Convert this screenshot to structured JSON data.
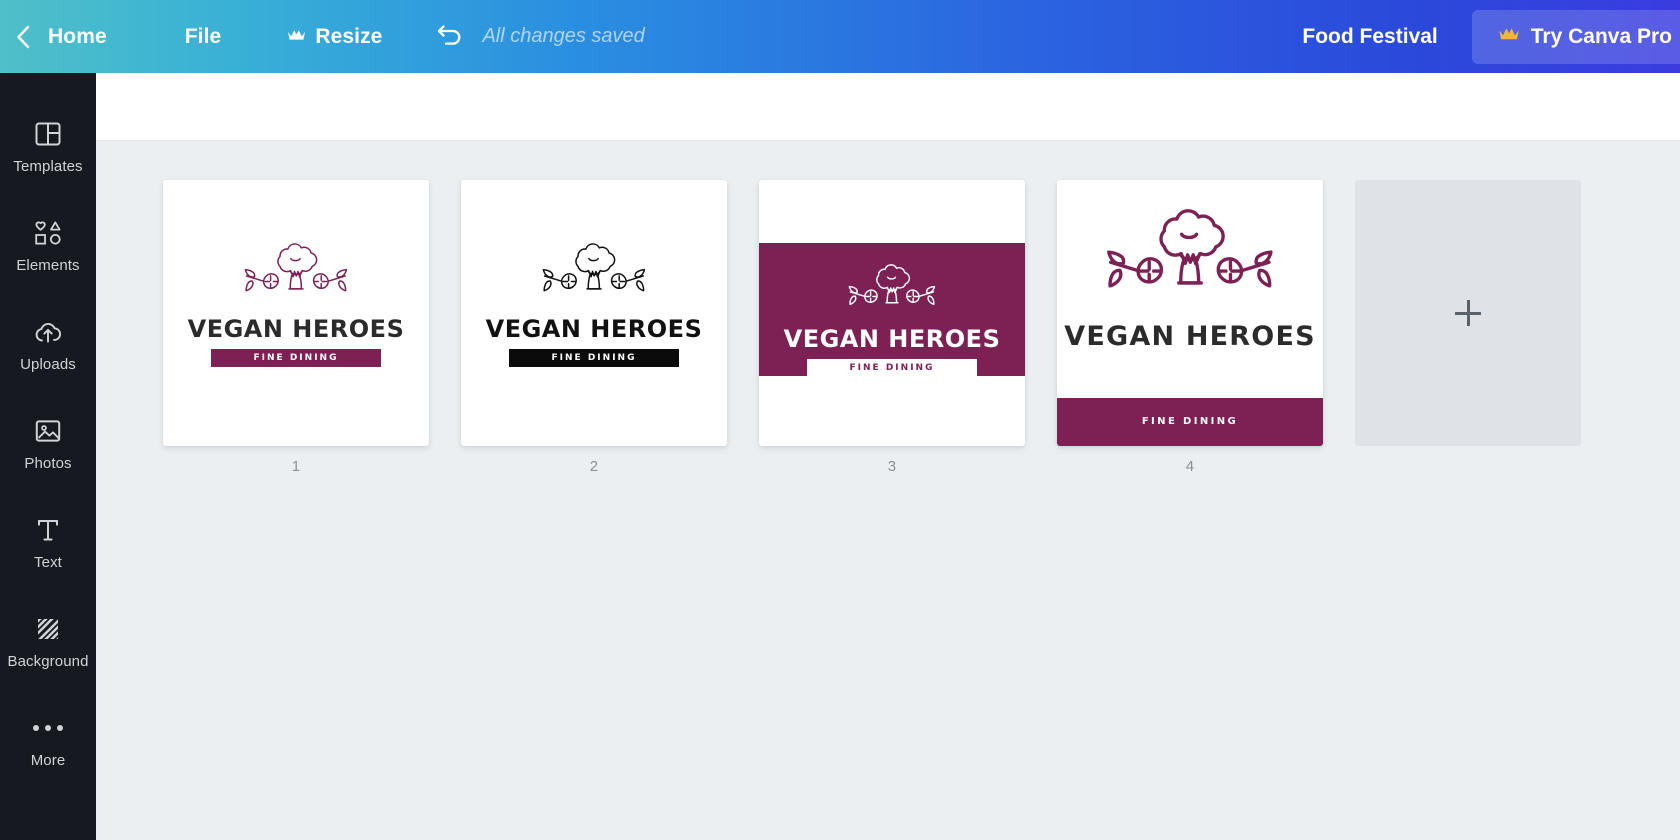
{
  "header": {
    "back_icon": "chevron-left-icon",
    "home_label": "Home",
    "file_label": "File",
    "resize_label": "Resize",
    "resize_crown_icon": "crown-icon",
    "undo_icon": "undo-arrow-icon",
    "save_status": "All changes saved",
    "doc_title": "Food Festival",
    "try_canva_label": "Try Canva Pro",
    "try_canva_crown_icon": "crown-icon",
    "gradient_from": "#4fc0c8",
    "gradient_to": "#3a3ce0"
  },
  "sidebar": {
    "items": [
      {
        "label": "Templates",
        "icon": "templates-icon"
      },
      {
        "label": "Elements",
        "icon": "elements-icon"
      },
      {
        "label": "Uploads",
        "icon": "upload-cloud-icon"
      },
      {
        "label": "Photos",
        "icon": "photo-icon"
      },
      {
        "label": "Text",
        "icon": "text-t-icon"
      },
      {
        "label": "Background",
        "icon": "background-hatch-icon"
      },
      {
        "label": "More",
        "icon": "more-dots-icon"
      }
    ],
    "background_color": "#16191f"
  },
  "canvas": {
    "background_color": "#eceff1",
    "brand_purple": "#7d2154",
    "add_page": {
      "label": "",
      "icon": "plus-icon"
    },
    "pages": [
      {
        "number": "1",
        "variant": "light-purple",
        "brand_name": "VEGAN HEROES",
        "tagline": "FINE DINING",
        "art": "broccoli-logo-icon"
      },
      {
        "number": "2",
        "variant": "black",
        "brand_name": "VEGAN HEROES",
        "tagline": "FINE DINING",
        "art": "broccoli-logo-icon"
      },
      {
        "number": "3",
        "variant": "purple-band",
        "brand_name": "VEGAN HEROES",
        "tagline": "FINE DINING",
        "art": "broccoli-logo-icon"
      },
      {
        "number": "4",
        "variant": "large-stacked",
        "brand_name": "VEGAN HEROES",
        "tagline": "FINE DINING",
        "art": "broccoli-logo-icon"
      }
    ]
  }
}
